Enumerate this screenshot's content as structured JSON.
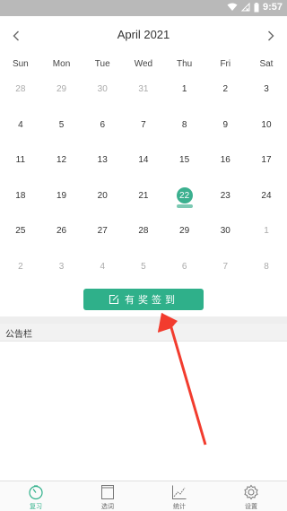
{
  "status_bar": {
    "time": "9:57"
  },
  "calendar": {
    "month_title": "April 2021",
    "weekdays": [
      "Sun",
      "Mon",
      "Tue",
      "Wed",
      "Thu",
      "Fri",
      "Sat"
    ],
    "weeks": [
      [
        {
          "d": "28",
          "o": true
        },
        {
          "d": "29",
          "o": true
        },
        {
          "d": "30",
          "o": true
        },
        {
          "d": "31",
          "o": true
        },
        {
          "d": "1"
        },
        {
          "d": "2"
        },
        {
          "d": "3"
        }
      ],
      [
        {
          "d": "4"
        },
        {
          "d": "5"
        },
        {
          "d": "6"
        },
        {
          "d": "7"
        },
        {
          "d": "8"
        },
        {
          "d": "9"
        },
        {
          "d": "10"
        }
      ],
      [
        {
          "d": "11"
        },
        {
          "d": "12"
        },
        {
          "d": "13"
        },
        {
          "d": "14"
        },
        {
          "d": "15"
        },
        {
          "d": "16"
        },
        {
          "d": "17"
        }
      ],
      [
        {
          "d": "18"
        },
        {
          "d": "19"
        },
        {
          "d": "20"
        },
        {
          "d": "21"
        },
        {
          "d": "22",
          "today": true
        },
        {
          "d": "23"
        },
        {
          "d": "24"
        }
      ],
      [
        {
          "d": "25"
        },
        {
          "d": "26"
        },
        {
          "d": "27"
        },
        {
          "d": "28"
        },
        {
          "d": "29"
        },
        {
          "d": "30"
        },
        {
          "d": "1",
          "o": true
        }
      ],
      [
        {
          "d": "2",
          "o": true
        },
        {
          "d": "3",
          "o": true
        },
        {
          "d": "4",
          "o": true
        },
        {
          "d": "5",
          "o": true
        },
        {
          "d": "6",
          "o": true
        },
        {
          "d": "7",
          "o": true
        },
        {
          "d": "8",
          "o": true
        }
      ]
    ],
    "today_color": "#3bb08f"
  },
  "checkin": {
    "label": "有奖签到",
    "icon": "edit-icon",
    "color": "#2fb08a"
  },
  "notice": {
    "label": "公告栏"
  },
  "tabbar": {
    "items": [
      {
        "label": "复习",
        "icon": "timer-icon",
        "active": true
      },
      {
        "label": "选词",
        "icon": "book-icon"
      },
      {
        "label": "统计",
        "icon": "chart-icon"
      },
      {
        "label": "设置",
        "icon": "gear-icon"
      }
    ],
    "accent": "#2fb08a"
  },
  "annotation": {
    "color": "#f23c2e"
  }
}
